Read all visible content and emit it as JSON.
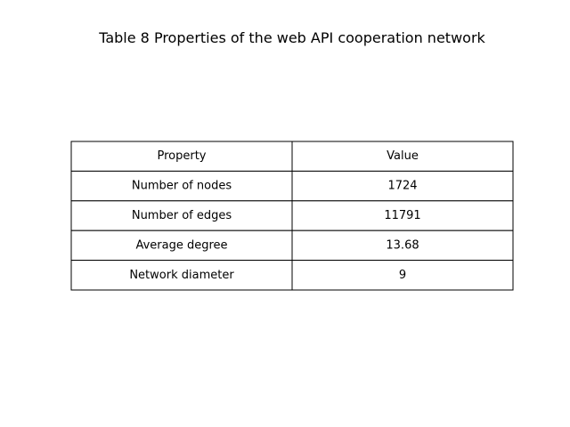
{
  "chart_data": {
    "type": "table",
    "title": "Table 8 Properties of the web API cooperation network",
    "columns": [
      "Property",
      "Value"
    ],
    "rows": [
      [
        "Number of nodes",
        "1724"
      ],
      [
        "Number of edges",
        "11791"
      ],
      [
        "Average degree",
        "13.68"
      ],
      [
        "Network diameter",
        "9"
      ]
    ],
    "colors": {
      "border": "#000000",
      "background": "#ffffff",
      "text": "#000000"
    }
  }
}
